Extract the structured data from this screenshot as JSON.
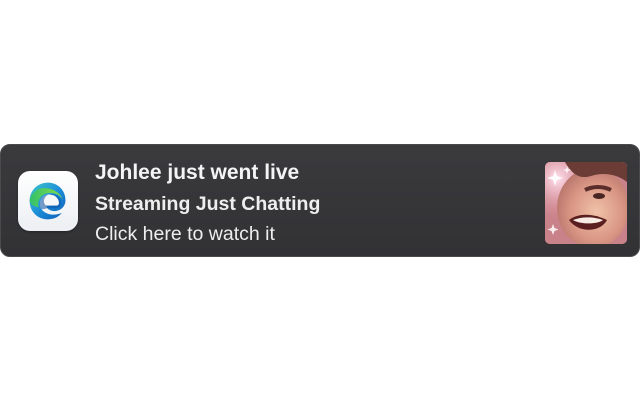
{
  "notification": {
    "title": "Johlee just went live",
    "subtitle": "Streaming Just Chatting",
    "body": "Click here to watch it",
    "app_icon": "microsoft-edge-icon",
    "thumbnail": "streamer-avatar"
  },
  "colors": {
    "background": "#ffffff",
    "banner": "#353538",
    "text": "#eeeeee",
    "edge_blue": "#1b7fd6",
    "edge_green": "#5cc45c"
  }
}
